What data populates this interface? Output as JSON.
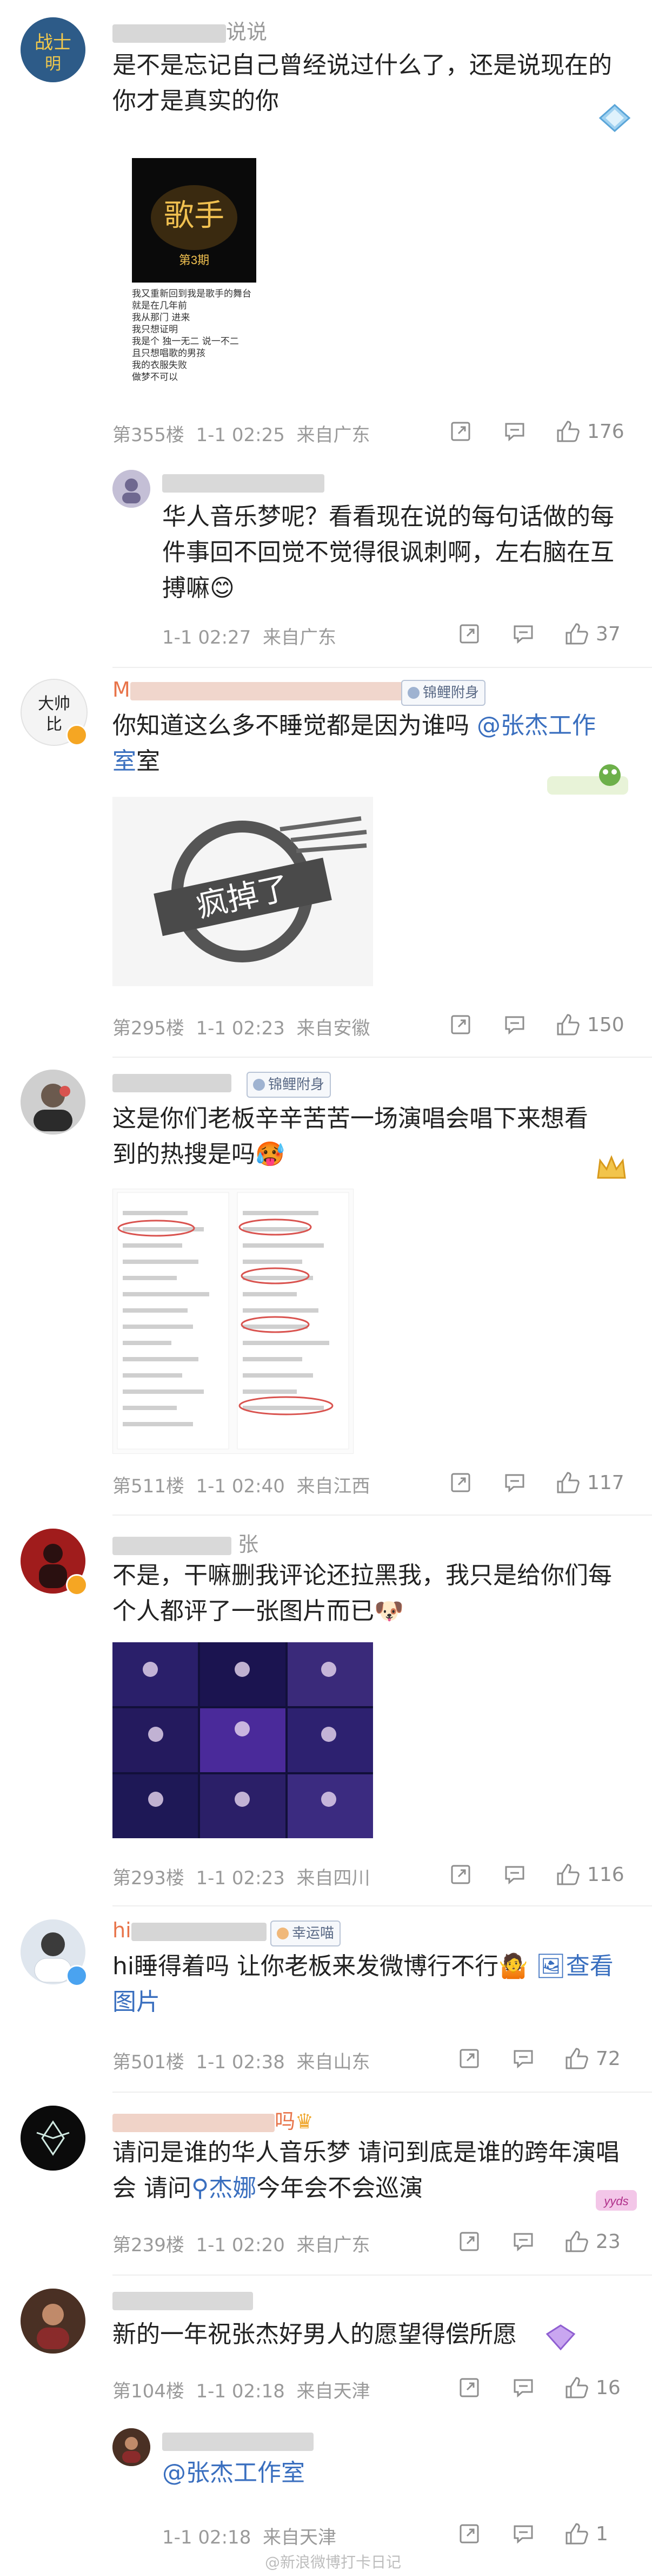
{
  "comments": [
    {
      "name_suffix": "说说",
      "text": "是不是忘记自己曾经说过什么了，还是说现在的你才是真实的你",
      "image_lines": [
        "我又重新回到我是歌手的舞台",
        "就是在几年前",
        "我从那门 进来",
        "我只想证明",
        "我是个 独一无二 说一不二",
        "且只想唱歌的男孩",
        "我的衣服失败",
        "做梦不可以"
      ],
      "image_caption": "第3期",
      "floor": "第355楼",
      "time": "1-1 02:25",
      "location": "来自广东",
      "likes": "176"
    },
    {
      "text": "华人音乐梦呢？看看现在说的每句话做的每件事回不回觉不觉得很讽刺啊，左右脑在互搏嘛😊",
      "time": "1-1 02:27",
      "location": "来自广东",
      "likes": "37"
    },
    {
      "name_prefix": "M",
      "badge": "锦鲤附身",
      "text_a": "你知道这么多不睡觉都是因为谁吗 ",
      "mention": "@张杰工作室",
      "stamp": "疯掉了",
      "floor": "第295楼",
      "time": "1-1 02:23",
      "location": "来自安徽",
      "likes": "150"
    },
    {
      "badge": "锦鲤附身",
      "text": "这是你们老板辛辛苦苦一场演唱会唱下来想看到的热搜是吗🥵",
      "floor": "第511楼",
      "time": "1-1 02:40",
      "location": "来自江西",
      "likes": "117"
    },
    {
      "name_suffix": "张",
      "text": "不是，干嘛删我评论还拉黑我，我只是给你们每个人都评了一张图片而已🐶",
      "floor": "第293楼",
      "time": "1-1 02:23",
      "location": "来自四川",
      "likes": "116"
    },
    {
      "name_prefix": "hi",
      "badge": "幸运喵",
      "text_a": "hi睡得着吗 让你老板来发微博行不行🤷 ",
      "view_image": "查看图片",
      "floor": "第501楼",
      "time": "1-1 02:38",
      "location": "来自山东",
      "likes": "72"
    },
    {
      "name_suffix": "吗",
      "text_a": "请问是谁的华人音乐梦 请问到底是谁的跨年演唱会 请问",
      "search_link": "杰娜",
      "text_b": "今年会不会巡演",
      "floor": "第239楼",
      "time": "1-1 02:20",
      "location": "来自广东",
      "likes": "23"
    },
    {
      "text": "新的一年祝张杰好男人的愿望得偿所愿",
      "floor": "第104楼",
      "time": "1-1 02:18",
      "location": "来自天津",
      "likes": "16"
    },
    {
      "mention": "@张杰工作室",
      "time": "1-1 02:18",
      "location": "来自天津",
      "likes": "1"
    }
  ],
  "watermark": "@新浪微博打卡日记",
  "colors": {
    "link": "#3a6fbf",
    "meta": "#9a9a9a",
    "name": "#e8744a",
    "divider": "#eeeeee"
  }
}
